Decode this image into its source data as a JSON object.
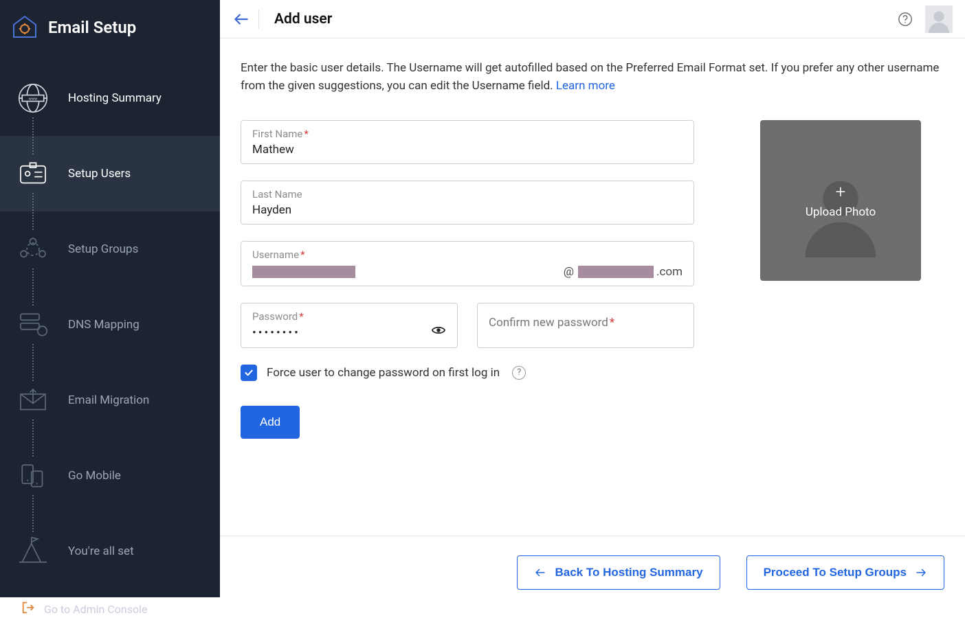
{
  "sidebar": {
    "title": "Email Setup",
    "items": [
      {
        "label": "Hosting Summary",
        "state": "past"
      },
      {
        "label": "Setup Users",
        "state": "active"
      },
      {
        "label": "Setup Groups",
        "state": "future"
      },
      {
        "label": "DNS Mapping",
        "state": "future"
      },
      {
        "label": "Email Migration",
        "state": "future"
      },
      {
        "label": "Go Mobile",
        "state": "future"
      },
      {
        "label": "You're all set",
        "state": "future"
      }
    ],
    "footer": "Go to Admin Console"
  },
  "header": {
    "title": "Add user"
  },
  "intro": {
    "text": "Enter the basic user details. The Username will get autofilled based on the Preferred Email Format set. If you prefer any other username from the given suggestions, you can edit the Username field.  ",
    "link": "Learn more"
  },
  "form": {
    "first_name": {
      "label": "First Name",
      "value": "Mathew"
    },
    "last_name": {
      "label": "Last Name",
      "value": "Hayden"
    },
    "username": {
      "label": "Username",
      "domain_suffix": ".com",
      "at": "@"
    },
    "password": {
      "label": "Password",
      "value": "••••••••"
    },
    "confirm": {
      "label": "Confirm new password"
    },
    "force_change": "Force user to change password on first log in",
    "add_button": "Add",
    "upload_label": "Upload Photo"
  },
  "footer_nav": {
    "back": "Back To Hosting Summary",
    "next": "Proceed To Setup Groups"
  }
}
